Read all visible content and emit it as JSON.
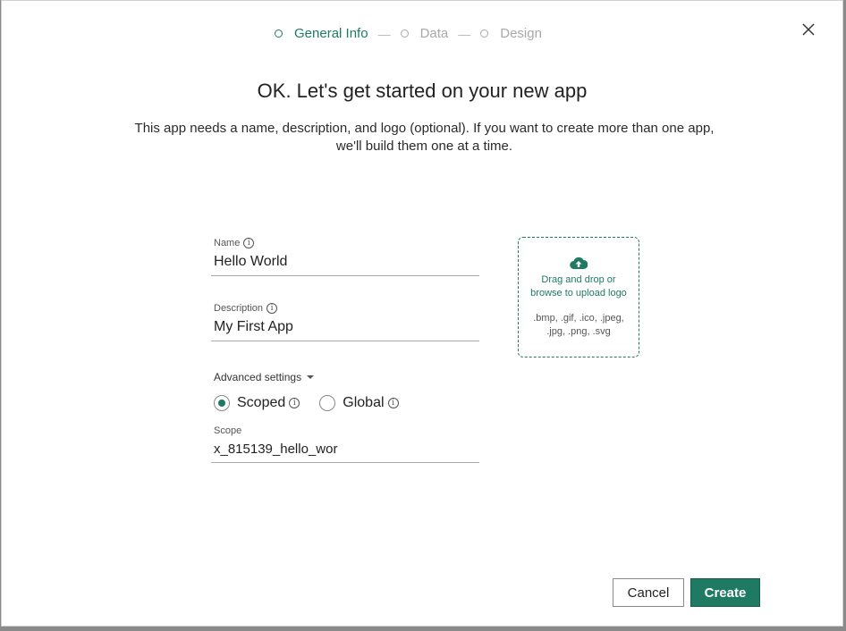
{
  "stepper": {
    "steps": [
      {
        "label": "General Info",
        "active": true
      },
      {
        "label": "Data",
        "active": false
      },
      {
        "label": "Design",
        "active": false
      }
    ],
    "separator": "—"
  },
  "dialog": {
    "title": "OK. Let's get started on your new app",
    "subtitle_line1": "This app needs a name, description, and logo (optional). If you want to create more than one app,",
    "subtitle_line2": "we'll build them one at a time."
  },
  "form": {
    "name": {
      "label": "Name",
      "value": "Hello World"
    },
    "description": {
      "label": "Description",
      "value": "My First App"
    },
    "advanced_settings_label": "Advanced settings",
    "scope_options": [
      {
        "label": "Scoped",
        "checked": true
      },
      {
        "label": "Global",
        "checked": false
      }
    ],
    "scope": {
      "label": "Scope",
      "value": "x_815139_hello_wor"
    }
  },
  "upload": {
    "line1": "Drag and drop or",
    "line2": "browse to upload logo",
    "types_line1": ".bmp, .gif, .ico, .jpeg,",
    "types_line2": ".jpg, .png, .svg"
  },
  "buttons": {
    "cancel": "Cancel",
    "create": "Create"
  },
  "colors": {
    "accent": "#1f7a64"
  },
  "icons": {
    "close": "close-icon",
    "info": "info-icon",
    "upload": "cloud-upload-icon",
    "caret": "caret-down-icon"
  }
}
